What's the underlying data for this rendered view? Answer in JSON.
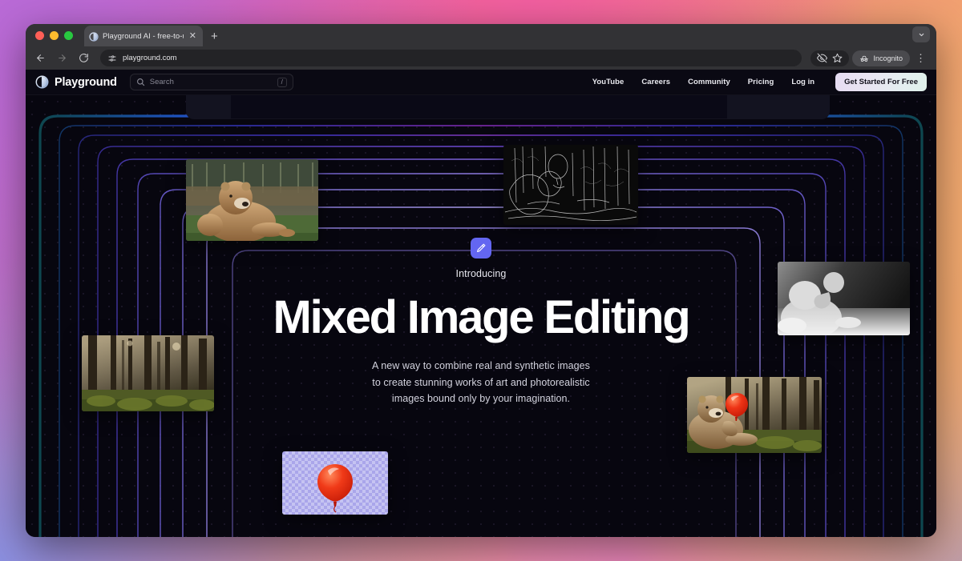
{
  "browser": {
    "tab": {
      "title": "Playground AI - free-to-use o",
      "favicon_icon": "playground-logo-icon",
      "close_icon": "close-icon"
    },
    "new_tab_label": "+",
    "window_chevron_icon": "chevron-down-icon",
    "traffic_lights": [
      "close-red",
      "minimize-yellow",
      "maximize-green"
    ],
    "toolbar": {
      "back_icon": "arrow-left-icon",
      "forward_icon": "arrow-right-icon",
      "reload_icon": "reload-icon",
      "site_settings_icon": "page-settings-icon",
      "url": "playground.com",
      "tracking_protection_icon": "eye-off-icon",
      "bookmark_icon": "star-icon",
      "incognito_icon": "incognito-icon",
      "incognito_label": "Incognito",
      "menu_icon": "kebab-menu-icon"
    }
  },
  "site": {
    "brand": {
      "name": "Playground",
      "logo_icon": "playground-logo-icon"
    },
    "search": {
      "placeholder": "Search",
      "icon": "search-icon",
      "shortcut": "/"
    },
    "nav": [
      {
        "label": "YouTube"
      },
      {
        "label": "Careers"
      },
      {
        "label": "Community"
      },
      {
        "label": "Pricing"
      },
      {
        "label": "Log in"
      }
    ],
    "cta_label": "Get Started For Free"
  },
  "hero": {
    "badge_icon": "magic-wand-icon",
    "eyebrow": "Introducing",
    "headline": "Mixed Image Editing",
    "subtitle_line_1": "A new way to combine real and synthetic images",
    "subtitle_line_2": "to create stunning works of art and photorealistic",
    "subtitle_line_3": "images bound only by your imagination.",
    "images": [
      {
        "name": "bear-photo",
        "alt": "Brown bear sitting on grass in front of fence"
      },
      {
        "name": "edge-map-image",
        "alt": "Canny edge-detection outline of bear holding balloon in forest"
      },
      {
        "name": "depth-map-image",
        "alt": "Grayscale depth map of bear holding balloon"
      },
      {
        "name": "forest-photo",
        "alt": "Sunlit pine forest with tall trees"
      },
      {
        "name": "balloon-cutout-image",
        "alt": "Red balloon on transparent checkerboard background"
      },
      {
        "name": "composite-result-image",
        "alt": "Bear holding red balloon composited into sunlit forest"
      }
    ]
  },
  "colors": {
    "accent_purple": "#6366f1",
    "page_background": "#07060f",
    "ring_magenta": "#c23bd0",
    "ring_blue": "#4545d8",
    "ring_teal": "#1f7f86",
    "cta_gradient_start": "#e6dcf2",
    "cta_gradient_end": "#dff0ea"
  }
}
